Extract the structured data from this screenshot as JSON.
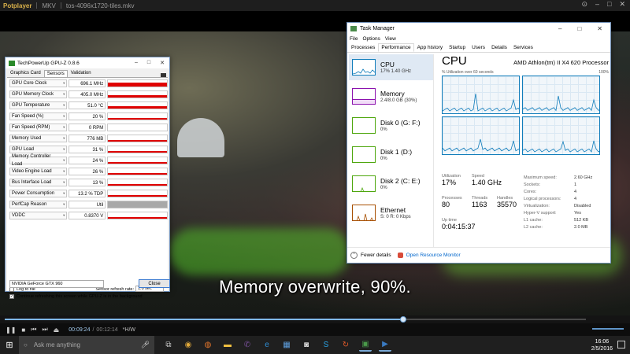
{
  "player": {
    "app_name": "Potplayer",
    "format": "MKV",
    "file_name": "tos-4096x1720-tiles.mkv",
    "subtitle": "Memory overwrite, 90%.",
    "time_current": "00:09:24",
    "time_total": "00:12:14",
    "codec_tag": "*H/W",
    "progress_fraction": 0.685
  },
  "gpuz": {
    "title": "TechPowerUp GPU-Z 0.8.6",
    "tabs": [
      "Graphics Card",
      "Sensors",
      "Validation"
    ],
    "active_tab": "Sensors",
    "sensors": [
      {
        "name": "GPU Core Clock",
        "value": "696.1 MHz",
        "level": 0.55
      },
      {
        "name": "GPU Memory Clock",
        "value": "405.0 MHz",
        "level": 0.35
      },
      {
        "name": "GPU Temperature",
        "value": "51.0 °C",
        "level": 0.3
      },
      {
        "name": "Fan Speed (%)",
        "value": "20 %",
        "level": 0.2
      },
      {
        "name": "Fan Speed (RPM)",
        "value": "0 RPM",
        "level": 0.0
      },
      {
        "name": "Memory Used",
        "value": "776 MB",
        "level": 0.2
      },
      {
        "name": "GPU Load",
        "value": "31 %",
        "level": 0.25
      },
      {
        "name": "Memory Controller Load",
        "value": "24 %",
        "level": 0.22
      },
      {
        "name": "Video Engine Load",
        "value": "26 %",
        "level": 0.25
      },
      {
        "name": "Bus Interface Load",
        "value": "13 %",
        "level": 0.12
      },
      {
        "name": "Power Consumption",
        "value": "13.2 % TDP",
        "level": 0.12
      },
      {
        "name": "PerfCap Reason",
        "value": "Util",
        "level": 1.0
      },
      {
        "name": "VDDC",
        "value": "0.8370 V",
        "level": 0.25
      }
    ],
    "log_to_file": "Log to file",
    "refresh_label": "Sensor refresh rate:",
    "refresh_value": "1.0 sec",
    "continue_label": "Continue refreshing this screen while GPU-Z is in the background",
    "gpu_name": "NVIDIA GeForce GTX 960",
    "close_label": "Close"
  },
  "taskmgr": {
    "title": "Task Manager",
    "menu": [
      "File",
      "Options",
      "View"
    ],
    "tabs": [
      "Processes",
      "Performance",
      "App history",
      "Startup",
      "Users",
      "Details",
      "Services"
    ],
    "active_tab": "Performance",
    "resources": [
      {
        "name": "CPU",
        "detail": "17% 1.40 GHz",
        "color": "#117dbb"
      },
      {
        "name": "Memory",
        "detail": "2.4/8.0 GB (30%)",
        "color": "#8b12ae"
      },
      {
        "name": "Disk 0 (G: F:)",
        "detail": "0%",
        "color": "#4da60c"
      },
      {
        "name": "Disk 1 (D:)",
        "detail": "0%",
        "color": "#4da60c"
      },
      {
        "name": "Disk 2 (C: E:)",
        "detail": "0%",
        "color": "#4da60c"
      },
      {
        "name": "Ethernet",
        "detail": "S: 0 R: 0 Kbps",
        "color": "#a74f01"
      }
    ],
    "cpu_heading": "CPU",
    "cpu_model": "AMD Athlon(tm) II X4 620 Processor",
    "graph_caption_left": "% Utilization over 60 seconds",
    "graph_caption_right": "100%",
    "stats": {
      "utilization_label": "Utilization",
      "utilization": "17%",
      "speed_label": "Speed",
      "speed": "1.40 GHz",
      "processes_label": "Processes",
      "processes": "80",
      "threads_label": "Threads",
      "threads": "1163",
      "handles_label": "Handles",
      "handles": "35570",
      "uptime_label": "Up time",
      "uptime": "0:04:15:37"
    },
    "specs": [
      {
        "k": "Maximum speed:",
        "v": "2.60 GHz"
      },
      {
        "k": "Sockets:",
        "v": "1"
      },
      {
        "k": "Cores:",
        "v": "4"
      },
      {
        "k": "Logical processors:",
        "v": "4"
      },
      {
        "k": "Virtualization:",
        "v": "Disabled"
      },
      {
        "k": "Hyper-V support:",
        "v": "Yes"
      },
      {
        "k": "L1 cache:",
        "v": "512 KB"
      },
      {
        "k": "L2 cache:",
        "v": "2.0 MB"
      }
    ],
    "fewer_details": "Fewer details",
    "resource_monitor": "Open Resource Monitor"
  },
  "taskbar": {
    "search_placeholder": "Ask me anything",
    "time": "16:06",
    "date": "2/5/2016",
    "apps": [
      "task-view-icon",
      "chrome-icon",
      "firefox-icon",
      "file-explorer-icon",
      "viber-icon",
      "edge-icon",
      "store-icon",
      "camera-icon",
      "skype-icon",
      "app-icon",
      "gpuz-taskbar-icon",
      "potplayer-taskbar-icon"
    ]
  }
}
